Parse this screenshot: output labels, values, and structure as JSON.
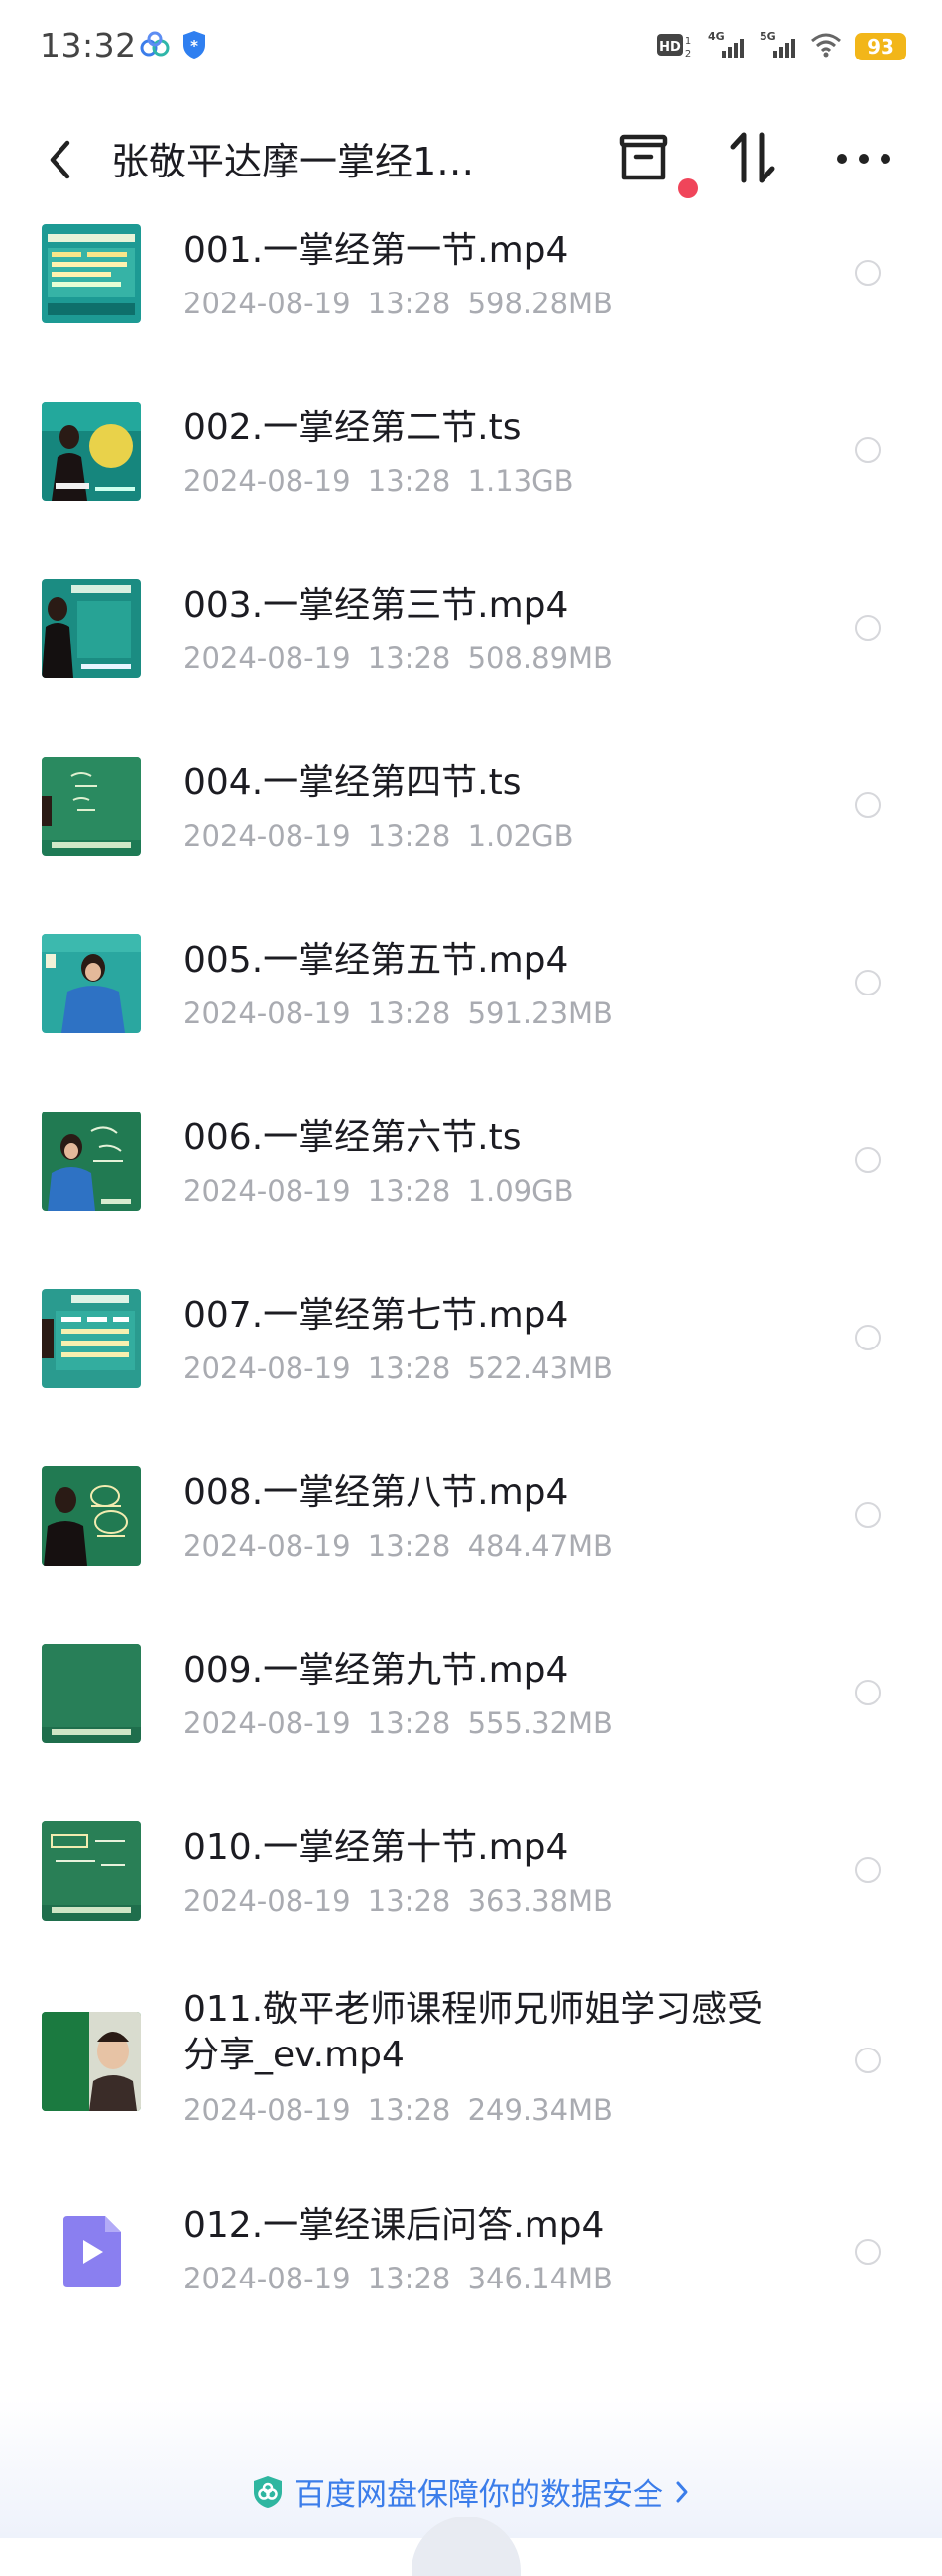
{
  "status_bar": {
    "time": "13:32",
    "battery": "93",
    "icons": [
      "cloud-app-icon",
      "baidu-app-icon",
      "hd-icon",
      "4g-signal-icon",
      "5g-signal-icon",
      "wifi-icon",
      "battery-icon"
    ],
    "hd_label": "HD",
    "net_4g": "4G",
    "net_5g": "5G",
    "battery_color": "#f2b619"
  },
  "header": {
    "title": "张敬平达摩一掌经1…",
    "back_icon": "chevron-left-icon",
    "actions": [
      "archive-icon",
      "sort-icon",
      "more-icon"
    ]
  },
  "files": [
    {
      "name": "001.一掌经第一节.mp4",
      "date": "2024-08-19",
      "time": "13:28",
      "size": "598.28MB",
      "thumb": "board"
    },
    {
      "name": "002.一掌经第二节.ts",
      "date": "2024-08-19",
      "time": "13:28",
      "size": "1.13GB",
      "thumb": "teacher"
    },
    {
      "name": "003.一掌经第三节.mp4",
      "date": "2024-08-19",
      "time": "13:28",
      "size": "508.89MB",
      "thumb": "teacher"
    },
    {
      "name": "004.一掌经第四节.ts",
      "date": "2024-08-19",
      "time": "13:28",
      "size": "1.02GB",
      "thumb": "chalkboard"
    },
    {
      "name": "005.一掌经第五节.mp4",
      "date": "2024-08-19",
      "time": "13:28",
      "size": "591.23MB",
      "thumb": "teacher"
    },
    {
      "name": "006.一掌经第六节.ts",
      "date": "2024-08-19",
      "time": "13:28",
      "size": "1.09GB",
      "thumb": "teacher"
    },
    {
      "name": "007.一掌经第七节.mp4",
      "date": "2024-08-19",
      "time": "13:28",
      "size": "522.43MB",
      "thumb": "board"
    },
    {
      "name": "008.一掌经第八节.mp4",
      "date": "2024-08-19",
      "time": "13:28",
      "size": "484.47MB",
      "thumb": "teacher"
    },
    {
      "name": "009.一掌经第九节.mp4",
      "date": "2024-08-19",
      "time": "13:28",
      "size": "555.32MB",
      "thumb": "chalkboard"
    },
    {
      "name": "010.一掌经第十节.mp4",
      "date": "2024-08-19",
      "time": "13:28",
      "size": "363.38MB",
      "thumb": "chalkboard"
    },
    {
      "name": "011.敬平老师课程师兄师姐学习感受分享_ev.mp4",
      "date": "2024-08-19",
      "time": "13:28",
      "size": "249.34MB",
      "thumb": "person"
    },
    {
      "name": "012.一掌经课后问答.mp4",
      "date": "2024-08-19",
      "time": "13:28",
      "size": "346.14MB",
      "thumb": "video-file-icon"
    }
  ],
  "footer": {
    "text": "百度网盘保障你的数据安全",
    "icon": "shield-icon",
    "accent": "#3b7dea"
  }
}
